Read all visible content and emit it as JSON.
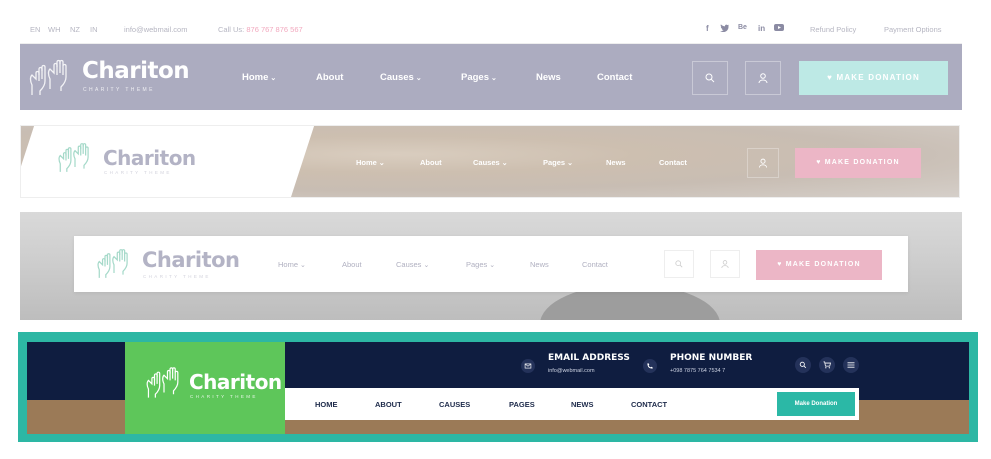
{
  "header1": {
    "topbar": {
      "languages": [
        "EN",
        "WH",
        "NZ",
        "IN"
      ],
      "email": "info@webmail.com",
      "call_label": "Call Us:",
      "call_number": "876 767 876 567",
      "social": [
        "f",
        "y",
        "Be",
        "in",
        "yt"
      ],
      "links": [
        "Refund Policy",
        "Payment Options"
      ]
    },
    "logo": {
      "title": "Chariton",
      "subtitle": "CHARITY THEME"
    },
    "nav": [
      "Home",
      "About",
      "Causes",
      "Pages",
      "News",
      "Contact"
    ],
    "donate": "MAKE DONATION",
    "colors": {
      "bar": "#acacc0",
      "donate": "#bde9e5"
    }
  },
  "header2": {
    "logo": {
      "title": "Chariton",
      "subtitle": "CHARITY THEME"
    },
    "nav": [
      "Home",
      "About",
      "Causes",
      "Pages",
      "News",
      "Contact"
    ],
    "donate": "MAKE DONATION",
    "colors": {
      "donate": "#ecb6c6"
    }
  },
  "header3": {
    "logo": {
      "title": "Chariton",
      "subtitle": "CHARITY THEME"
    },
    "nav": [
      "Home",
      "About",
      "Causes",
      "Pages",
      "News",
      "Contact"
    ],
    "donate": "MAKE DONATION",
    "colors": {
      "donate": "#ecb6c6"
    }
  },
  "header4": {
    "logo": {
      "title": "Chariton",
      "subtitle": "CHARITY THEME"
    },
    "email_title": "EMAIL ADDRESS",
    "email_value": "info@webmail.com",
    "phone_title": "PHONE NUMBER",
    "phone_value": "+098 7875 764 7534 7",
    "nav": [
      "HOME",
      "ABOUT",
      "CAUSES",
      "PAGES",
      "NEWS",
      "CONTACT"
    ],
    "donate": "Make Donation",
    "colors": {
      "frame": "#2db7a4",
      "navy": "#0f1d40",
      "green": "#5ec65a",
      "donate": "#2bb8a6"
    }
  }
}
